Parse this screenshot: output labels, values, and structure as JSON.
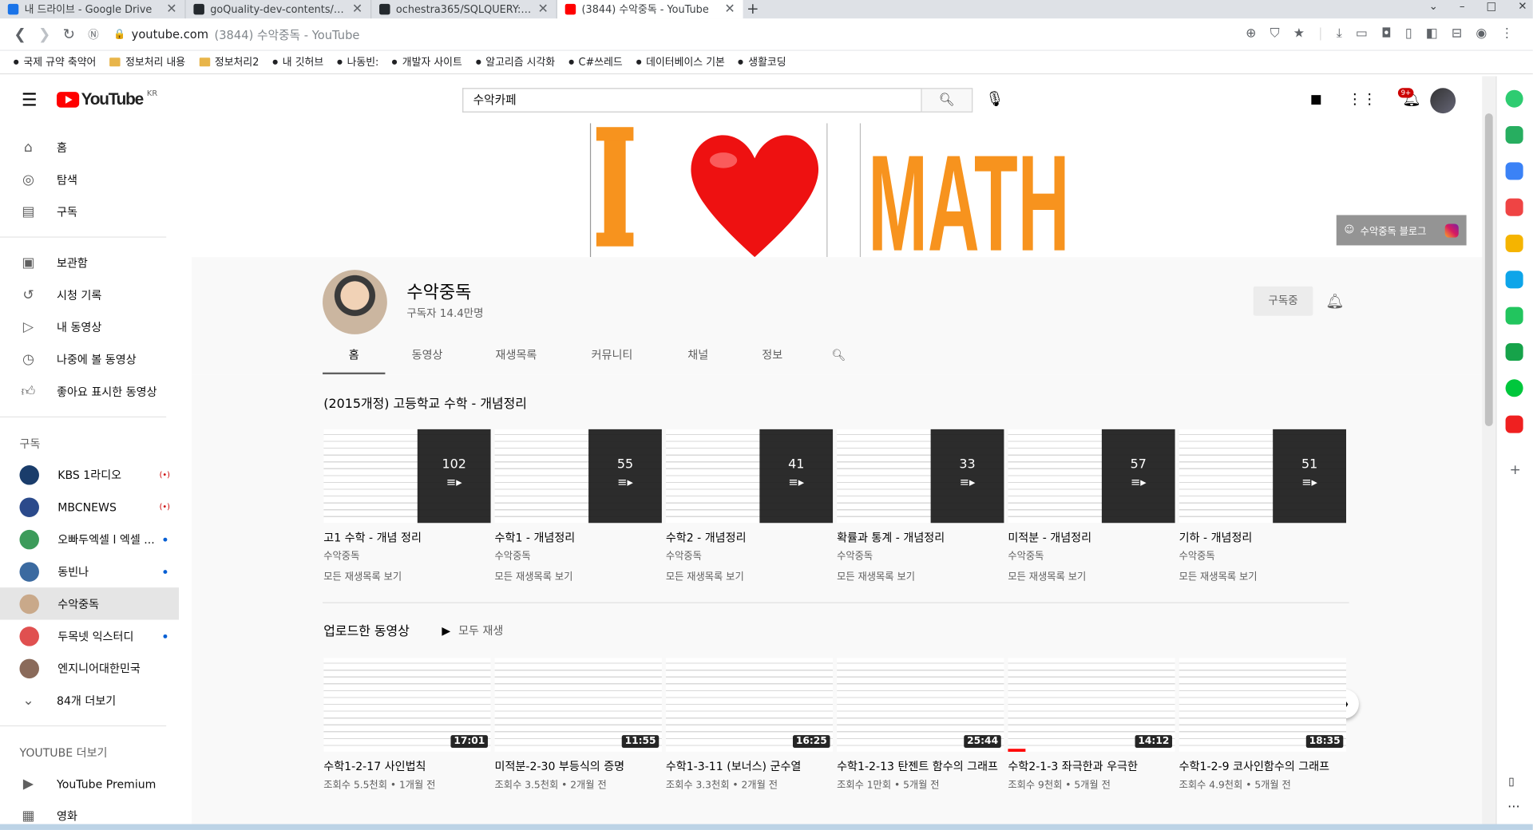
{
  "browser": {
    "tabs": [
      {
        "title": "내 드라이브 - Google Drive",
        "fav": "#1a73e8"
      },
      {
        "title": "goQuality-dev-contents/1. 개발",
        "fav": "#24292e"
      },
      {
        "title": "ochestra365/SQLQUERY: 다시공",
        "fav": "#24292e"
      },
      {
        "title": "(3844) 수악중독 - YouTube",
        "fav": "#ff0000"
      }
    ],
    "url_host": "youtube.com",
    "url_rest": "(3844) 수악중독 - YouTube",
    "bookmarks": [
      "국제 규약 축약어",
      "정보처리 내용",
      "정보처리2",
      "내 깃허브",
      "나동빈:",
      "개발자 사이트",
      "알고리즘 시각화",
      "C#쓰레드",
      "데이터베이스 기본",
      "생활코딩"
    ]
  },
  "yt": {
    "logo": "YouTube",
    "logo_region": "KR",
    "search_value": "수악카페",
    "notif_count": "9+"
  },
  "guide": {
    "main": [
      {
        "icon": "home-icon",
        "label": "홈"
      },
      {
        "icon": "explore-icon",
        "label": "탐색"
      },
      {
        "icon": "subscriptions-icon",
        "label": "구독"
      }
    ],
    "library": [
      {
        "icon": "library-icon",
        "label": "보관함"
      },
      {
        "icon": "history-icon",
        "label": "시청 기록"
      },
      {
        "icon": "your-videos-icon",
        "label": "내 동영상"
      },
      {
        "icon": "watch-later-icon",
        "label": "나중에 볼 동영상"
      },
      {
        "icon": "liked-icon",
        "label": "좋아요 표시한 동영상"
      }
    ],
    "subs_header": "구독",
    "subs": [
      {
        "label": "KBS 1라디오",
        "color": "#1a3d6b",
        "live": "(•)"
      },
      {
        "label": "MBCNEWS",
        "color": "#2b4a8b",
        "live": "(•)"
      },
      {
        "label": "오빠두엑셀 l 엑셀 ...",
        "color": "#3c9b5a",
        "dot": true
      },
      {
        "label": "동빈나",
        "color": "#3b6aa0",
        "dot": true
      },
      {
        "label": "수악중독",
        "color": "#c9a98a",
        "sel": true
      },
      {
        "label": "두목넷 익스터디",
        "color": "#e05050",
        "dot": true
      },
      {
        "label": "엔지니어대한민국",
        "color": "#8a6a5a"
      }
    ],
    "more": "84개 더보기",
    "more_header": "YOUTUBE 더보기",
    "extra": [
      {
        "icon": "youtube-premium-icon",
        "label": "YouTube Premium"
      },
      {
        "icon": "movies-icon",
        "label": "영화"
      }
    ]
  },
  "banner": {
    "blog_label": "수악중독 블로그"
  },
  "channel": {
    "name": "수악중독",
    "subscribers": "구독자 14.4만명",
    "subscribe_label": "구독중",
    "tabs": [
      "홈",
      "동영상",
      "재생목록",
      "커뮤니티",
      "채널",
      "정보"
    ]
  },
  "shelf1": {
    "title": "(2015개정) 고등학교 수학 - 개념정리",
    "cards": [
      {
        "title": "고1 수학 - 개념 정리",
        "count": "102",
        "channel": "수악중독",
        "link": "모든 재생목록 보기"
      },
      {
        "title": "수학1 - 개념정리",
        "count": "55",
        "channel": "수악중독",
        "link": "모든 재생목록 보기"
      },
      {
        "title": "수학2 - 개념정리",
        "count": "41",
        "channel": "수악중독",
        "link": "모든 재생목록 보기"
      },
      {
        "title": "확률과 통계 - 개념정리",
        "count": "33",
        "channel": "수악중독",
        "link": "모든 재생목록 보기"
      },
      {
        "title": "미적분 - 개념정리",
        "count": "57",
        "channel": "수악중독",
        "link": "모든 재생목록 보기"
      },
      {
        "title": "기하 - 개념정리",
        "count": "51",
        "channel": "수악중독",
        "link": "모든 재생목록 보기"
      }
    ]
  },
  "shelf2": {
    "title": "업로드한 동영상",
    "play_all": "모두 재생",
    "cards": [
      {
        "title": "수학1-2-17 사인법칙",
        "duration": "17:01",
        "meta": "조회수 5.5천회 • 1개월 전"
      },
      {
        "title": "미적분-2-30 부등식의 증명",
        "duration": "11:55",
        "meta": "조회수 3.5천회 • 2개월 전"
      },
      {
        "title": "수학1-3-11 (보너스) 군수열",
        "duration": "16:25",
        "meta": "조회수 3.3천회 • 2개월 전"
      },
      {
        "title": "수학1-2-13 탄젠트 함수의 그래프",
        "duration": "25:44",
        "meta": "조회수 1만회 • 5개월 전"
      },
      {
        "title": "수학2-1-3 좌극한과 우극한",
        "duration": "14:12",
        "meta": "조회수 9천회 • 5개월 전"
      },
      {
        "title": "수학1-2-9 코사인함수의 그래프",
        "duration": "18:35",
        "meta": "조회수 4.9천회 • 5개월 전"
      }
    ]
  }
}
